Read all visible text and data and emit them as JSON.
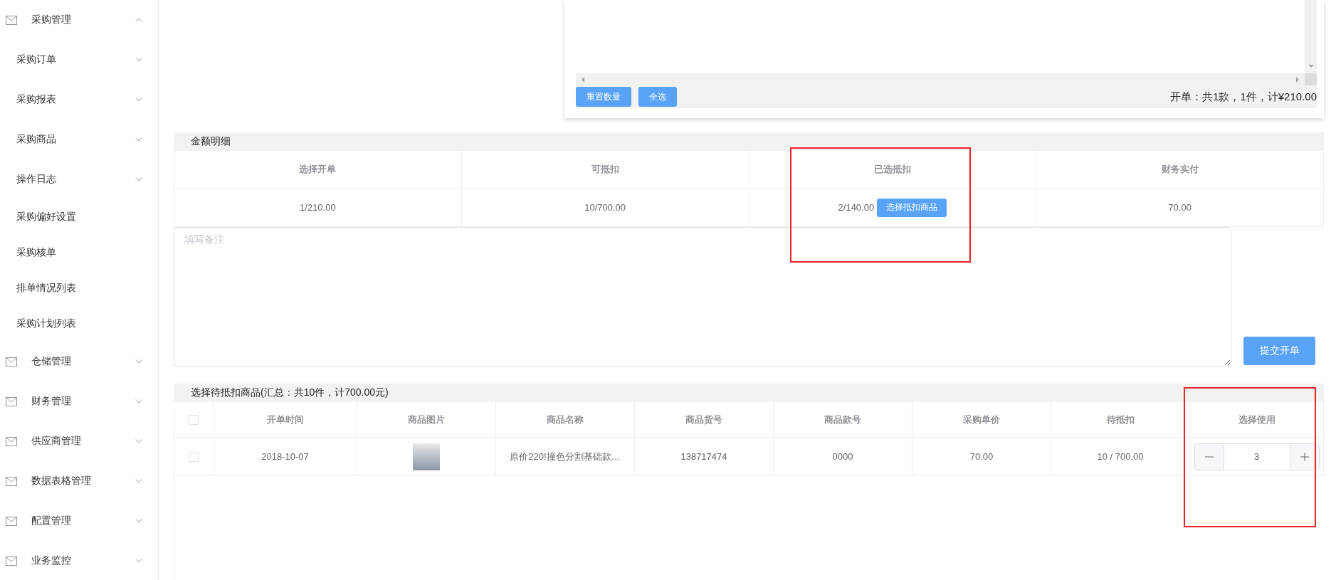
{
  "sidebar": {
    "items": [
      {
        "label": "采购管理",
        "expanded": true,
        "children": [
          {
            "label": "采购订单",
            "kind": "submenu"
          },
          {
            "label": "采购报表",
            "kind": "submenu"
          },
          {
            "label": "采购商品",
            "kind": "submenu"
          },
          {
            "label": "操作日志",
            "kind": "submenu"
          },
          {
            "label": "采购偏好设置",
            "kind": "link"
          },
          {
            "label": "采购核单",
            "kind": "link"
          },
          {
            "label": "排单情况列表",
            "kind": "link"
          },
          {
            "label": "采购计划列表",
            "kind": "link"
          }
        ]
      },
      {
        "label": "仓储管理",
        "expanded": false
      },
      {
        "label": "财务管理",
        "expanded": false
      },
      {
        "label": "供应商管理",
        "expanded": false
      },
      {
        "label": "数据表格管理",
        "expanded": false
      },
      {
        "label": "配置管理",
        "expanded": false
      },
      {
        "label": "业务监控",
        "expanded": false
      }
    ]
  },
  "order_panel": {
    "buttons": [
      "重置数量",
      "全选"
    ],
    "summary": "开单：共1款，1件，计¥210.00"
  },
  "amount_details": {
    "title": "金额明细",
    "columns": [
      "选择开单",
      "可抵扣",
      "已选抵扣",
      "财务实付"
    ],
    "values": [
      "1/210.00",
      "10/700.00",
      "2/140.00",
      "70.00"
    ],
    "select_button": "选择抵扣商品"
  },
  "remarks": {
    "placeholder": "填写备注"
  },
  "submit_button": "提交开单",
  "deduction": {
    "title": "选择待抵扣商品(汇总：共10件，计700.00元)",
    "select_all_checked": false,
    "columns": [
      "开单时间",
      "商品图片",
      "商品名称",
      "商品货号",
      "商品款号",
      "采购单价",
      "待抵扣",
      "选择使用"
    ],
    "rows": [
      {
        "checked": false,
        "time": "2018-10-07",
        "name": "原价220!撞色分割基础款…",
        "sku": "138717474",
        "style_no": "0000",
        "unit_price": "70.00",
        "pending": "10 / 700.00",
        "quantity": "3"
      }
    ]
  }
}
